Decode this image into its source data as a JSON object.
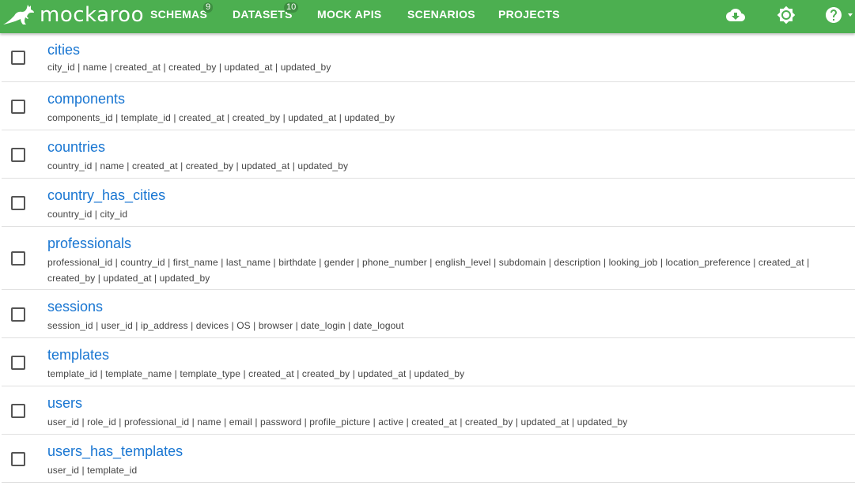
{
  "brand": {
    "name": "mockaroo",
    "color": "#4caf50"
  },
  "nav": [
    {
      "label": "SCHEMAS",
      "badge": "9"
    },
    {
      "label": "DATASETS",
      "badge": "10"
    },
    {
      "label": "MOCK APIS",
      "badge": ""
    },
    {
      "label": "SCENARIOS",
      "badge": ""
    },
    {
      "label": "PROJECTS",
      "badge": ""
    }
  ],
  "toolbar_icons": [
    "cloud-download-icon",
    "brightness-icon",
    "help-icon"
  ],
  "tables": [
    {
      "name": "cities",
      "columns": "city_id | name | created_at | created_by | updated_at | updated_by"
    },
    {
      "name": "components",
      "columns": "components_id | template_id | created_at | created_by | updated_at | updated_by"
    },
    {
      "name": "countries",
      "columns": "country_id | name | created_at | created_by | updated_at | updated_by"
    },
    {
      "name": "country_has_cities",
      "columns": "country_id | city_id"
    },
    {
      "name": "professionals",
      "columns": "professional_id | country_id | first_name | last_name | birthdate | gender | phone_number | english_level | subdomain | description | looking_job | location_preference | created_at | created_by | updated_at | updated_by"
    },
    {
      "name": "sessions",
      "columns": "session_id | user_id | ip_address | devices | OS | browser | date_login | date_logout"
    },
    {
      "name": "templates",
      "columns": "template_id | template_name | template_type | created_at | created_by | updated_at | updated_by"
    },
    {
      "name": "users",
      "columns": "user_id | role_id | professional_id | name | email | password | profile_picture | active | created_at | created_by | updated_at | updated_by"
    },
    {
      "name": "users_has_templates",
      "columns": "user_id | template_id"
    }
  ]
}
